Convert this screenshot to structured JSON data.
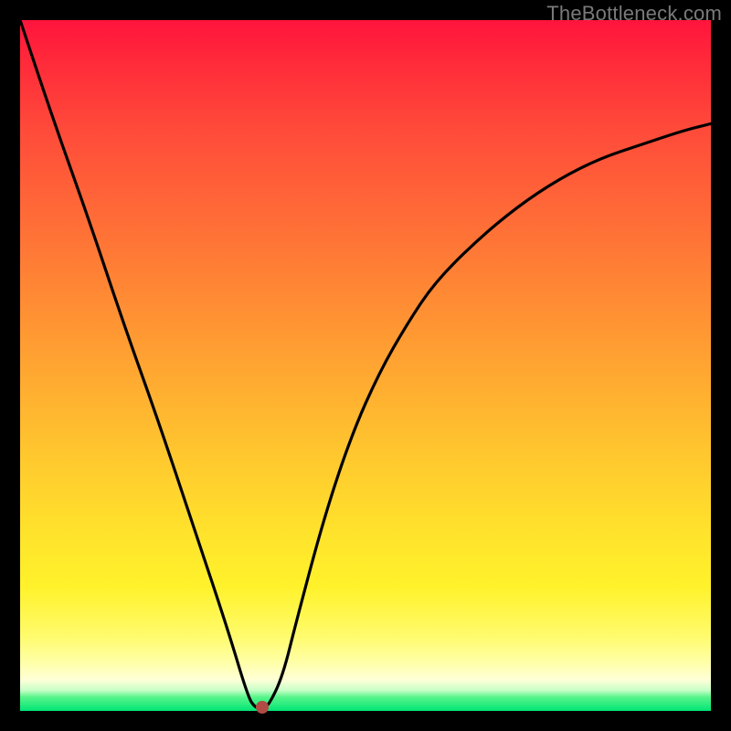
{
  "watermark": {
    "text": "TheBottleneck.com"
  },
  "chart_data": {
    "type": "line",
    "title": "",
    "xlabel": "",
    "ylabel": "",
    "xlim": [
      0,
      100
    ],
    "ylim": [
      0,
      100
    ],
    "grid": false,
    "background_gradient": {
      "stops": [
        {
          "pos": 0,
          "color": "#ff143c"
        },
        {
          "pos": 50,
          "color": "#ff9a33"
        },
        {
          "pos": 80,
          "color": "#ffee2c"
        },
        {
          "pos": 95,
          "color": "#ffffd0"
        },
        {
          "pos": 100,
          "color": "#00e676"
        }
      ]
    },
    "series": [
      {
        "name": "bottleneck-curve",
        "x": [
          0,
          5,
          10,
          15,
          20,
          25,
          30,
          33,
          34,
          35,
          36,
          38,
          40,
          44,
          48,
          52,
          56,
          60,
          66,
          72,
          78,
          84,
          90,
          96,
          100
        ],
        "values": [
          100,
          85,
          71,
          56,
          42,
          27,
          12,
          2,
          0.5,
          0.3,
          0.8,
          5,
          13,
          28,
          40,
          49,
          56,
          62,
          68,
          73,
          77,
          80,
          82,
          84,
          85
        ]
      }
    ],
    "annotations": [
      {
        "name": "min-marker",
        "x": 35,
        "y": 0.5,
        "color": "#b24b45"
      }
    ]
  },
  "colors": {
    "curve": "#000000",
    "marker": "#b24b45",
    "frame": "#000000"
  }
}
